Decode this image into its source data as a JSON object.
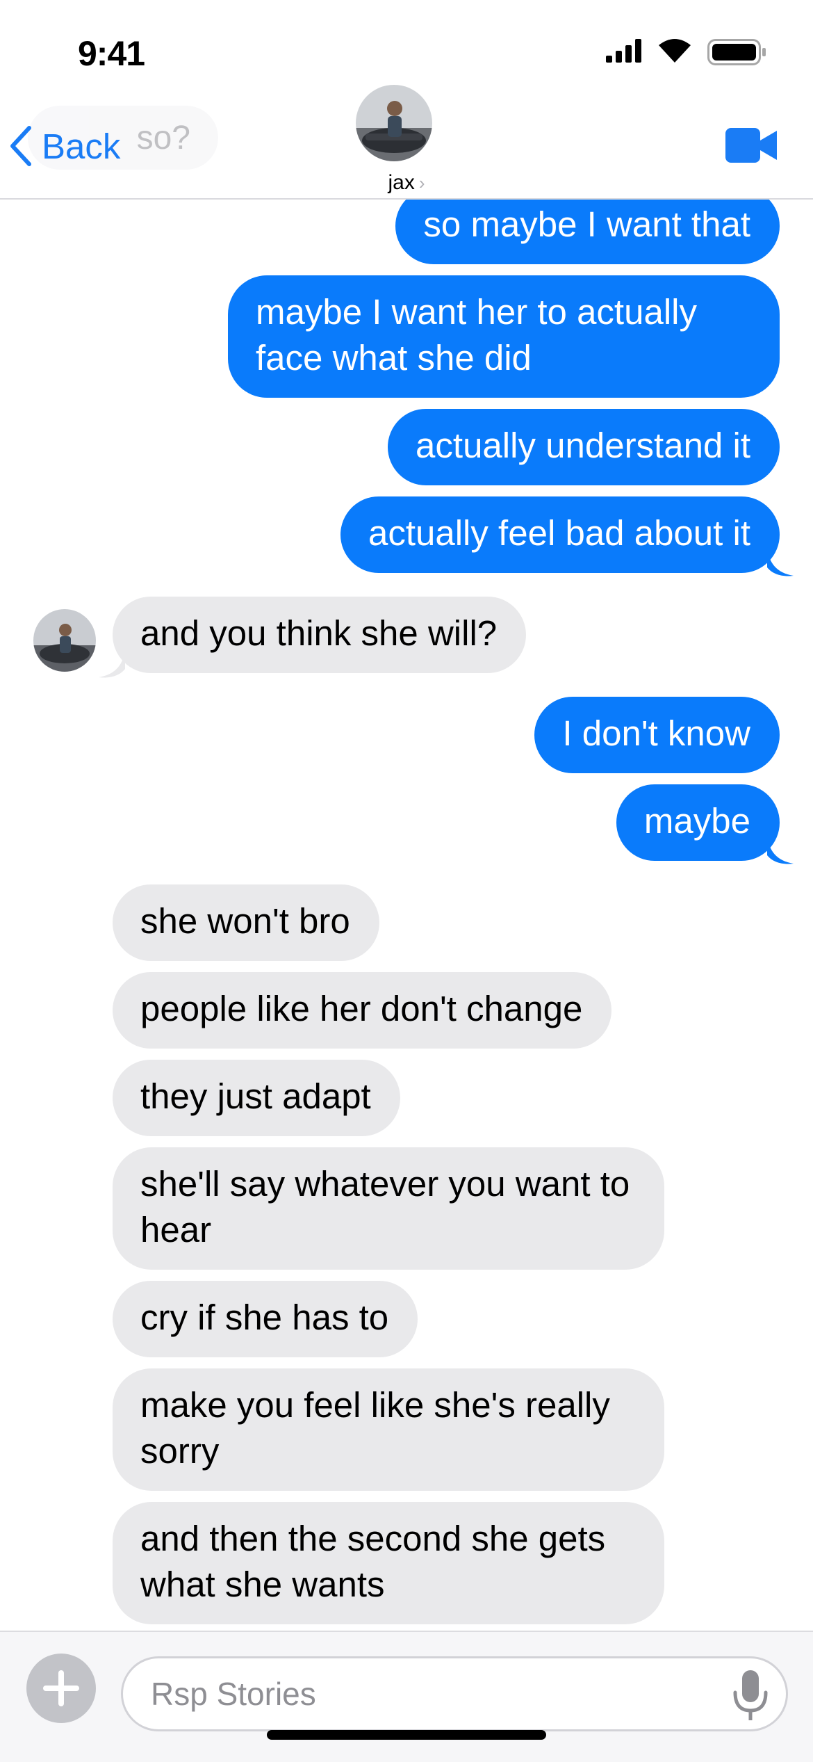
{
  "status_bar": {
    "time": "9:41",
    "icons": [
      "cellular-signal-icon",
      "wifi-icon",
      "battery-icon"
    ]
  },
  "header": {
    "back_label": "Back",
    "preview_text": "so?",
    "contact_name": "jax",
    "chevron": "›",
    "video_icon": "video-camera-icon",
    "accent_color": "#1a7cf5"
  },
  "messages": [
    {
      "side": "out",
      "text": "so maybe I want that"
    },
    {
      "side": "out",
      "text": "maybe I want her to actually face what she did"
    },
    {
      "side": "out",
      "text": "actually understand it"
    },
    {
      "side": "out",
      "text": "actually feel bad about it"
    },
    {
      "side": "in",
      "text": "and you think she will?"
    },
    {
      "side": "out",
      "text": "I don't know"
    },
    {
      "side": "out",
      "text": "maybe"
    },
    {
      "side": "in",
      "text": "she won't bro"
    },
    {
      "side": "in",
      "text": "people like her don't change"
    },
    {
      "side": "in",
      "text": "they just adapt"
    },
    {
      "side": "in",
      "text": "she'll say whatever you want to hear"
    },
    {
      "side": "in",
      "text": "cry if she has to"
    },
    {
      "side": "in",
      "text": "make you feel like she's really sorry"
    },
    {
      "side": "in",
      "text": "and then the second she gets what she wants"
    }
  ],
  "colors": {
    "outgoing_bubble": "#0a7bfb",
    "incoming_bubble": "#e9e9eb"
  },
  "composer": {
    "placeholder": "Rsp Stories",
    "plus_icon": "plus-icon",
    "mic_icon": "microphone-icon"
  }
}
